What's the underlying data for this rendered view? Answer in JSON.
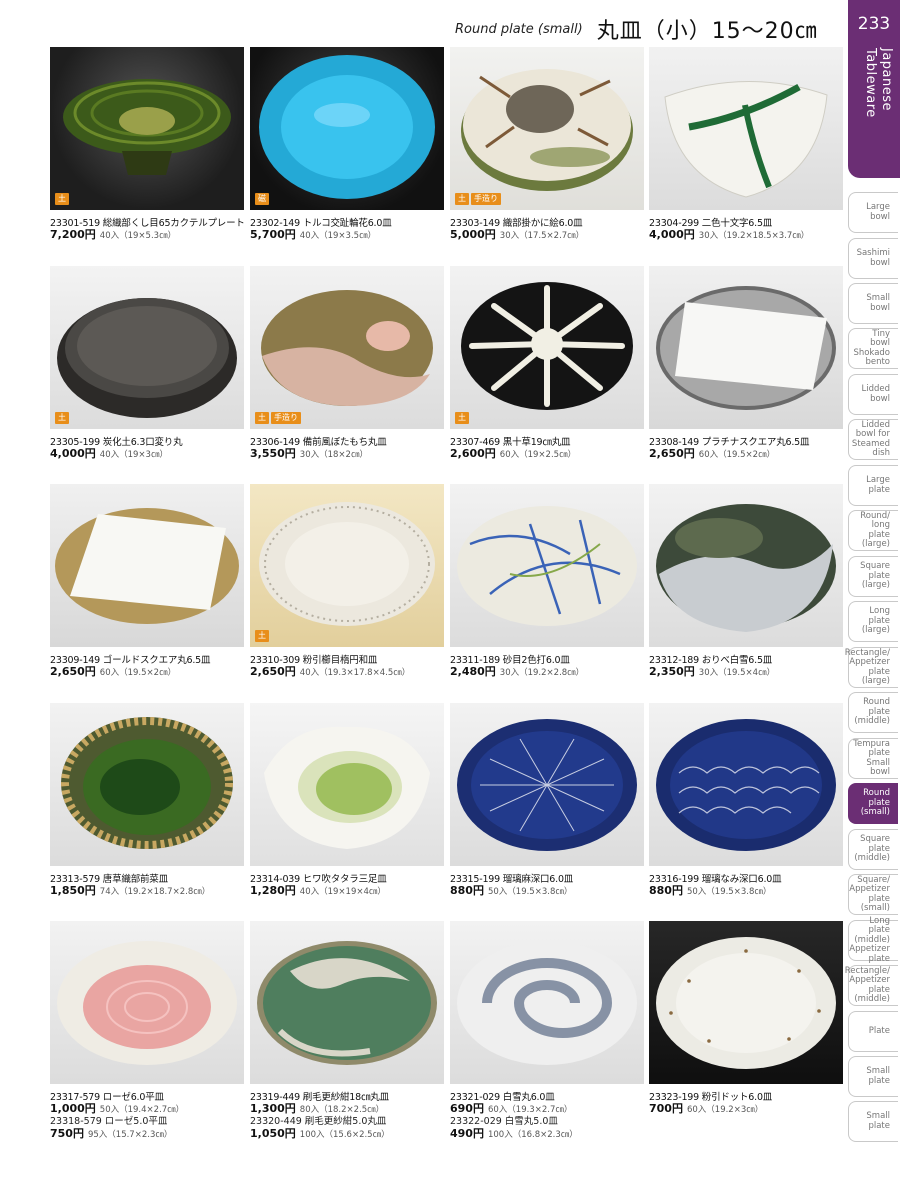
{
  "header": {
    "title_en": "Round plate (small)",
    "title_jp": "丸皿（小）15〜20㎝",
    "page_number": "233",
    "section": "Japanese Tableware"
  },
  "sidebar": [
    {
      "label": "Large\nbowl",
      "active": false
    },
    {
      "label": "Sashimi\nbowl",
      "active": false
    },
    {
      "label": "Small\nbowl",
      "active": false
    },
    {
      "label": "Tiny\nbowl\nShokado\nbento",
      "active": false
    },
    {
      "label": "Lidded\nbowl",
      "active": false
    },
    {
      "label": "Lidded\nbowl for\nSteamed\ndish",
      "active": false
    },
    {
      "label": "Large\nplate",
      "active": false
    },
    {
      "label": "Round/\nlong plate\n(large)",
      "active": false
    },
    {
      "label": "Square\nplate\n(large)",
      "active": false
    },
    {
      "label": "Long\nplate\n(large)",
      "active": false
    },
    {
      "label": "Rectangle/\nAppetizer\nplate\n(large)",
      "active": false
    },
    {
      "label": "Round\nplate\n(middle)",
      "active": false
    },
    {
      "label": "Tempura\nplate\nSmall\nbowl",
      "active": false
    },
    {
      "label": "Round\nplate\n(small)",
      "active": true
    },
    {
      "label": "Square\nplate\n(middle)",
      "active": false
    },
    {
      "label": "Square/\nAppetizer\nplate\n(small)",
      "active": false
    },
    {
      "label": "Long plate\n(middle)\nAppetizer\nplate",
      "active": false
    },
    {
      "label": "Rectangle/\nAppetizer\nplate\n(middle)",
      "active": false
    },
    {
      "label": "Plate",
      "active": false
    },
    {
      "label": "Small\nplate",
      "active": false
    },
    {
      "label": "Small\nplate",
      "active": false
    }
  ],
  "products": [
    {
      "line1": "23301-519 総織部くし目65カクテルプレート",
      "price1": "7,200円",
      "qty1": "40入（19×5.3㎝）",
      "tags": [
        "土"
      ]
    },
    {
      "line1": "23302-149 トルコ交趾輪花6.0皿",
      "price1": "5,700円",
      "qty1": "40入（19×3.5㎝）",
      "tags": [
        "磁"
      ]
    },
    {
      "line1": "23303-149 織部掛かに絵6.0皿",
      "price1": "5,000円",
      "qty1": "30入（17.5×2.7㎝）",
      "tags": [
        "土",
        "手造り"
      ]
    },
    {
      "line1": "23304-299 二色十文字6.5皿",
      "price1": "4,000円",
      "qty1": "30入（19.2×18.5×3.7㎝）",
      "tags": []
    },
    {
      "line1": "23305-199 炭化土6.3口変り丸",
      "price1": "4,000円",
      "qty1": "40入（19×3㎝）",
      "tags": [
        "土"
      ]
    },
    {
      "line1": "23306-149 備前風ぼたもち丸皿",
      "price1": "3,550円",
      "qty1": "30入（18×2㎝）",
      "tags": [
        "土",
        "手造り"
      ]
    },
    {
      "line1": "23307-469 黒十草19㎝丸皿",
      "price1": "2,600円",
      "qty1": "60入（19×2.5㎝）",
      "tags": [
        "土"
      ]
    },
    {
      "line1": "23308-149 プラチナスクエア丸6.5皿",
      "price1": "2,650円",
      "qty1": "60入（19.5×2㎝）",
      "tags": []
    },
    {
      "line1": "23309-149 ゴールドスクエア丸6.5皿",
      "price1": "2,650円",
      "qty1": "60入（19.5×2㎝）",
      "tags": []
    },
    {
      "line1": "23310-309 粉引櫛目楕円和皿",
      "price1": "2,650円",
      "qty1": "40入（19.3×17.8×4.5㎝）",
      "tags": [
        "土"
      ]
    },
    {
      "line1": "23311-189 砂目2色打6.0皿",
      "price1": "2,480円",
      "qty1": "30入（19.2×2.8㎝）",
      "tags": []
    },
    {
      "line1": "23312-189 おりべ白雪6.5皿",
      "price1": "2,350円",
      "qty1": "30入（19.5×4㎝）",
      "tags": []
    },
    {
      "line1": "23313-579 唐草織部前菜皿",
      "price1": "1,850円",
      "qty1": "74入（19.2×18.7×2.8㎝）",
      "tags": []
    },
    {
      "line1": "23314-039 ヒワ吹タタラ三足皿",
      "price1": "1,280円",
      "qty1": "40入（19×19×4㎝）",
      "tags": []
    },
    {
      "line1": "23315-199 瑠璃麻深口6.0皿",
      "price1": "880円",
      "qty1": "50入（19.5×3.8㎝）",
      "tags": []
    },
    {
      "line1": "23316-199 瑠璃なみ深口6.0皿",
      "price1": "880円",
      "qty1": "50入（19.5×3.8㎝）",
      "tags": []
    },
    {
      "line1": "23317-579 ローゼ6.0平皿",
      "price1": "1,000円",
      "qty1": "50入（19.4×2.7㎝）",
      "line2": "23318-579 ローゼ5.0平皿",
      "price2": "750円",
      "qty2": "95入（15.7×2.3㎝）",
      "tags": []
    },
    {
      "line1": "23319-449 刷毛更紗紺18㎝丸皿",
      "price1": "1,300円",
      "qty1": "80入（18.2×2.5㎝）",
      "line2": "23320-449 刷毛更紗紺5.0丸皿",
      "price2": "1,050円",
      "qty2": "100入（15.6×2.5㎝）",
      "tags": []
    },
    {
      "line1": "23321-029 白雪丸6.0皿",
      "price1": "690円",
      "qty1": "60入（19.3×2.7㎝）",
      "line2": "23322-029 白雪丸5.0皿",
      "price2": "490円",
      "qty2": "100入（16.8×2.3㎝）",
      "tags": []
    },
    {
      "line1": "23323-199 粉引ドット6.0皿",
      "price1": "700円",
      "qty1": "60入（19.2×3㎝）",
      "tags": []
    }
  ]
}
